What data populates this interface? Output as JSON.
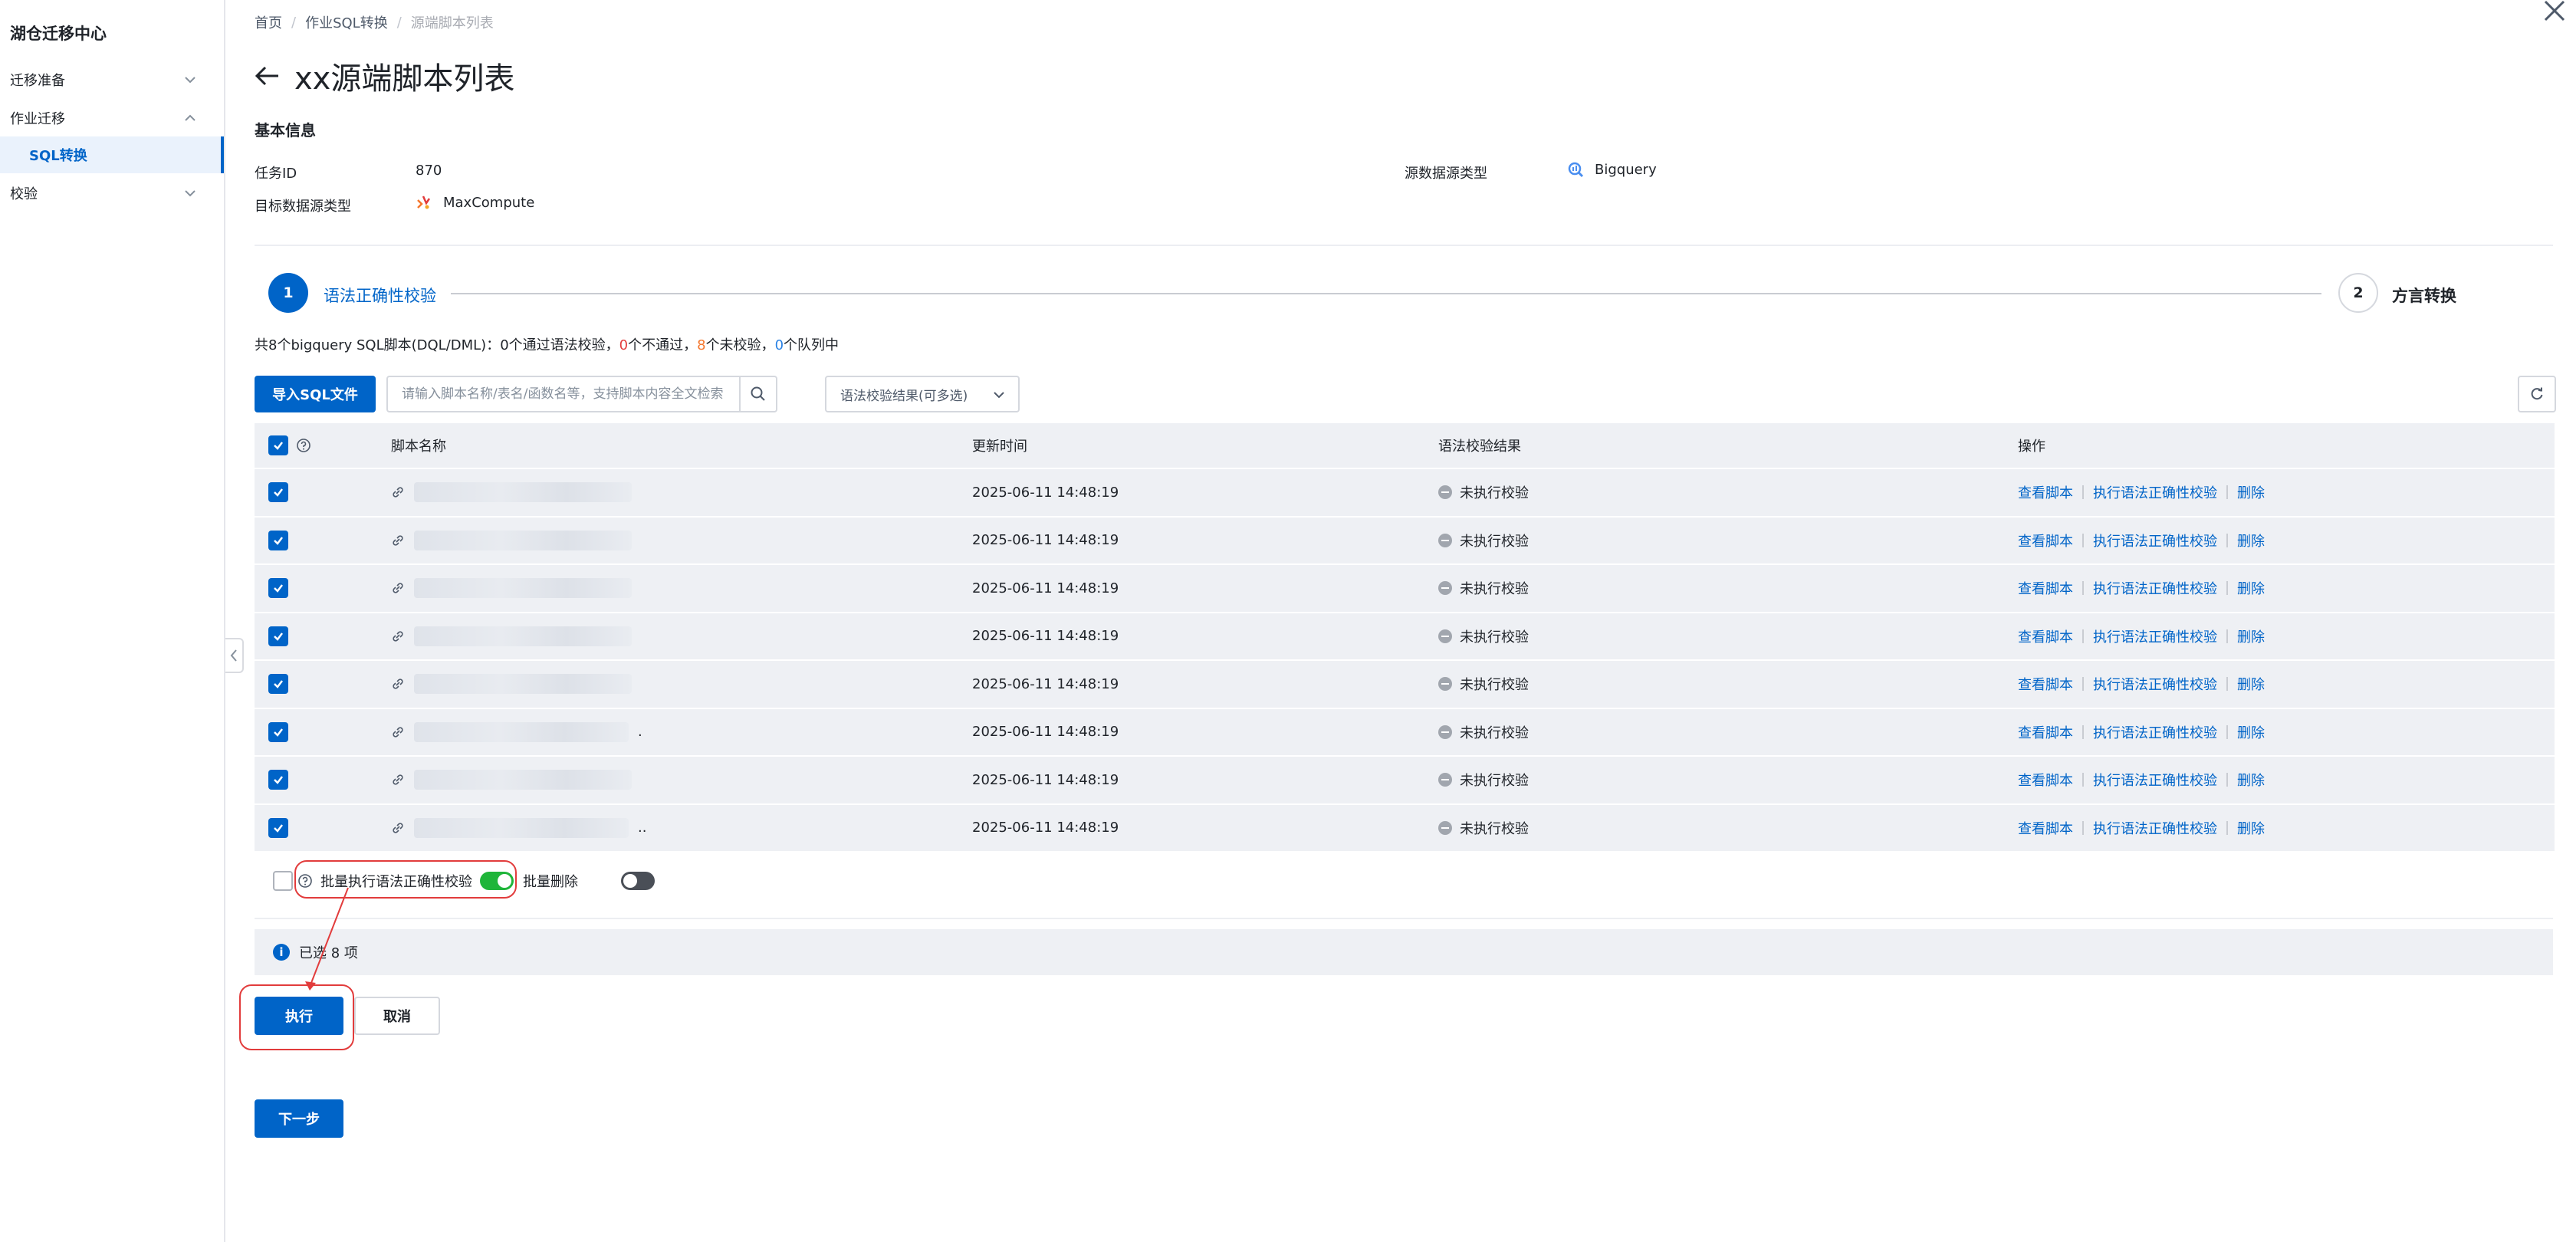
{
  "sidebar": {
    "title": "湖仓迁移中心",
    "items": [
      {
        "label": "迁移准备"
      },
      {
        "label": "作业迁移"
      },
      {
        "label": "SQL转换"
      },
      {
        "label": "校验"
      }
    ]
  },
  "breadcrumb": {
    "home": "首页",
    "parent": "作业SQL转换",
    "current": "源端脚本列表"
  },
  "page": {
    "title": "xx源端脚本列表"
  },
  "basic_info": {
    "section_title": "基本信息",
    "task_id_label": "任务ID",
    "task_id_value": "870",
    "source_type_label": "源数据源类型",
    "source_type_value": "Bigquery",
    "target_type_label": "目标数据源类型",
    "target_type_value": "MaxCompute"
  },
  "steps": [
    {
      "number": "1",
      "label": "语法正确性校验"
    },
    {
      "number": "2",
      "label": "方言转换"
    }
  ],
  "summary": {
    "prefix": "共",
    "total": "8",
    "mid": "个bigquery SQL脚本(DQL/DML)：",
    "passed": "0",
    "passed_text": "个通过语法校验，",
    "failed": "0",
    "failed_text": "个不通过，",
    "unchecked": "8",
    "unchecked_text": "个未校验，",
    "queued": "0",
    "queued_text": "个队列中"
  },
  "toolbar": {
    "import_label": "导入SQL文件",
    "search_placeholder": "请输入脚本名称/表名/函数名等，支持脚本内容全文检索",
    "filter_placeholder": "语法校验结果(可多选)"
  },
  "table": {
    "headers": {
      "name": "脚本名称",
      "updated": "更新时间",
      "result": "语法校验结果",
      "ops": "操作"
    },
    "rows": [
      {
        "updated": "2025-06-11 14:48:19",
        "result": "未执行校验",
        "suffix": ""
      },
      {
        "updated": "2025-06-11 14:48:19",
        "result": "未执行校验",
        "suffix": ""
      },
      {
        "updated": "2025-06-11 14:48:19",
        "result": "未执行校验",
        "suffix": ""
      },
      {
        "updated": "2025-06-11 14:48:19",
        "result": "未执行校验",
        "suffix": ""
      },
      {
        "updated": "2025-06-11 14:48:19",
        "result": "未执行校验",
        "suffix": ""
      },
      {
        "updated": "2025-06-11 14:48:19",
        "result": "未执行校验",
        "suffix": "."
      },
      {
        "updated": "2025-06-11 14:48:19",
        "result": "未执行校验",
        "suffix": ""
      },
      {
        "updated": "2025-06-11 14:48:19",
        "result": "未执行校验",
        "suffix": ".."
      }
    ],
    "ops": {
      "view": "查看脚本",
      "run_check": "执行语法正确性校验",
      "delete": "删除"
    }
  },
  "batch": {
    "batch_check_label": "批量执行语法正确性校验",
    "batch_delete_label": "批量删除"
  },
  "selection": {
    "text": "已选 8 项"
  },
  "actions": {
    "execute": "执行",
    "cancel": "取消",
    "next": "下一步"
  },
  "colors": {
    "primary": "#0064c8",
    "highlight": "#e23c3c",
    "toggle_on": "#1fb53a",
    "count_red": "#e23c3c",
    "count_orange": "#f5762c",
    "count_blue": "#2a82e4"
  }
}
